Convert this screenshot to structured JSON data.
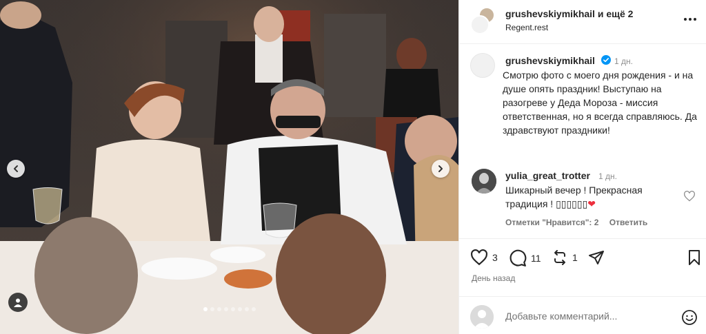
{
  "header": {
    "username": "grushevskiymikhail",
    "and_more": "и ещё 2",
    "location": "Regent.rest",
    "more_icon": "more-horizontal-icon"
  },
  "caption": {
    "username": "grushevskiymikhail",
    "verified": true,
    "time": "1 дн.",
    "text": "Смотрю фото с моего дня рождения - и на душе опять праздник! Выступаю на разогреве у Деда Мороза - миссия ответственная, но я всегда справляюсь. Да здравствуют праздники!"
  },
  "comment": {
    "username": "yulia_great_trotter",
    "time": "1 дн.",
    "text": "Шикарный вечер ! Прекрасная традиция ! ▯▯▯▯▯▯",
    "heart": "❤",
    "likes_label": "Отметки \"Нравится\": 2",
    "reply_label": "Ответить"
  },
  "actions": {
    "likes_count": "3",
    "comments_count": "11",
    "reposts_count": "1",
    "date": "День назад"
  },
  "add_comment": {
    "placeholder": "Добавьте комментарий..."
  },
  "carousel": {
    "slide_count": 8,
    "active_index": 0
  },
  "colors": {
    "verified_blue": "#0095f6",
    "heart_red": "#ed2f3d",
    "text_primary": "#262626",
    "text_secondary": "#737373"
  }
}
